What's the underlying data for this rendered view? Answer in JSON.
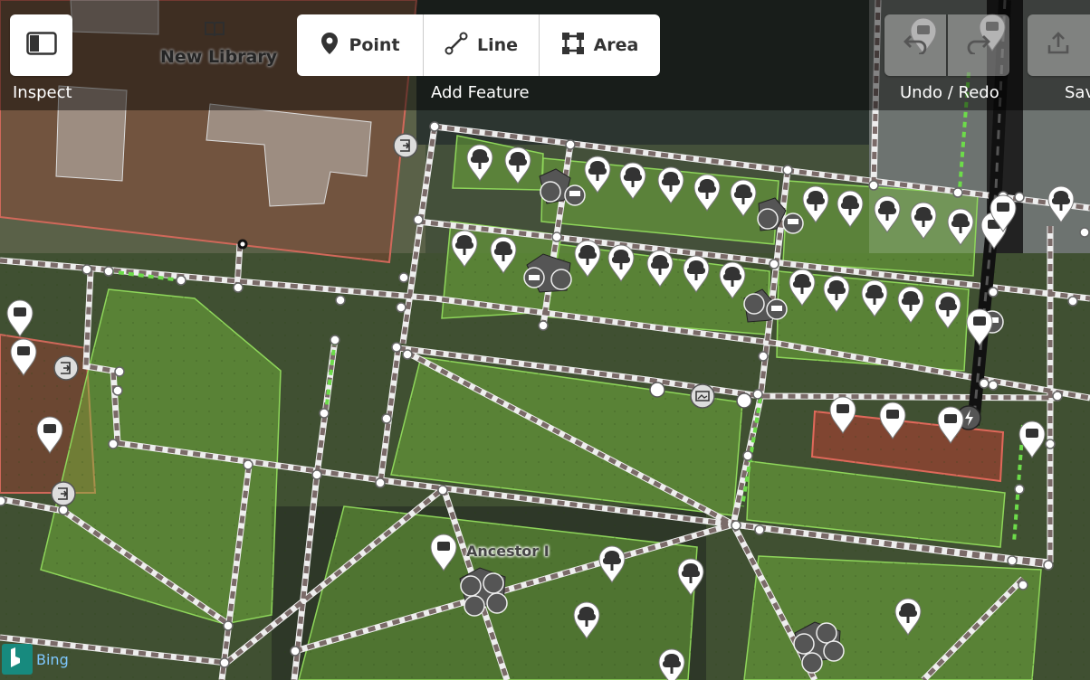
{
  "toolbar": {
    "inspect_label": "Inspect",
    "add_feature_label": "Add Feature",
    "point_label": "Point",
    "line_label": "Line",
    "area_label": "Area",
    "undo_redo_label": "Undo / Redo",
    "save_label": "Save"
  },
  "map": {
    "labels": {
      "new_library": "New Library",
      "ancestor": "Ancestor I"
    },
    "imagery_provider": "Bing"
  }
}
